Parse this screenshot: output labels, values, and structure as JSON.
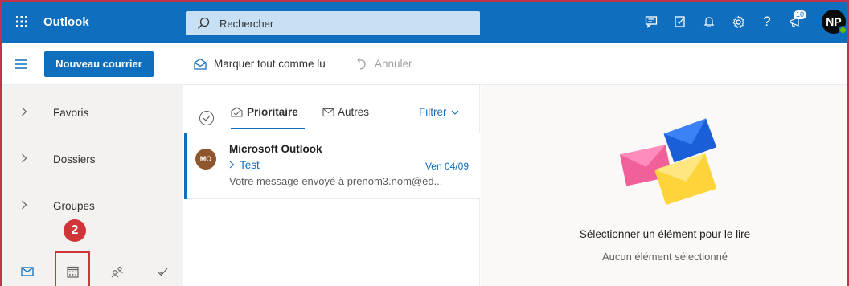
{
  "topbar": {
    "app_title": "Outlook",
    "search_placeholder": "Rechercher",
    "notification_badge": "10",
    "avatar_initials": "NP",
    "colors": {
      "accent": "#106ebe",
      "search_bg": "#c7e0f4"
    }
  },
  "commandbar": {
    "new_mail": "Nouveau courrier",
    "mark_all_read": "Marquer tout comme lu",
    "undo": "Annuler"
  },
  "leftnav": {
    "items": [
      {
        "label": "Favoris"
      },
      {
        "label": "Dossiers"
      },
      {
        "label": "Groupes"
      }
    ],
    "step_badge": "2",
    "modules": [
      "mail-icon",
      "calendar-icon",
      "people-icon",
      "todo-icon"
    ]
  },
  "maillist": {
    "tabs": {
      "focused": "Prioritaire",
      "other": "Autres",
      "filter": "Filtrer"
    },
    "items": [
      {
        "avatar": "MO",
        "from": "Microsoft Outlook",
        "subject": "Test",
        "date": "Ven 04/09",
        "preview": "Votre message envoyé à prenom3.nom@ed..."
      }
    ]
  },
  "reading": {
    "title": "Sélectionner un élément pour le lire",
    "subtitle": "Aucun élément sélectionné"
  }
}
